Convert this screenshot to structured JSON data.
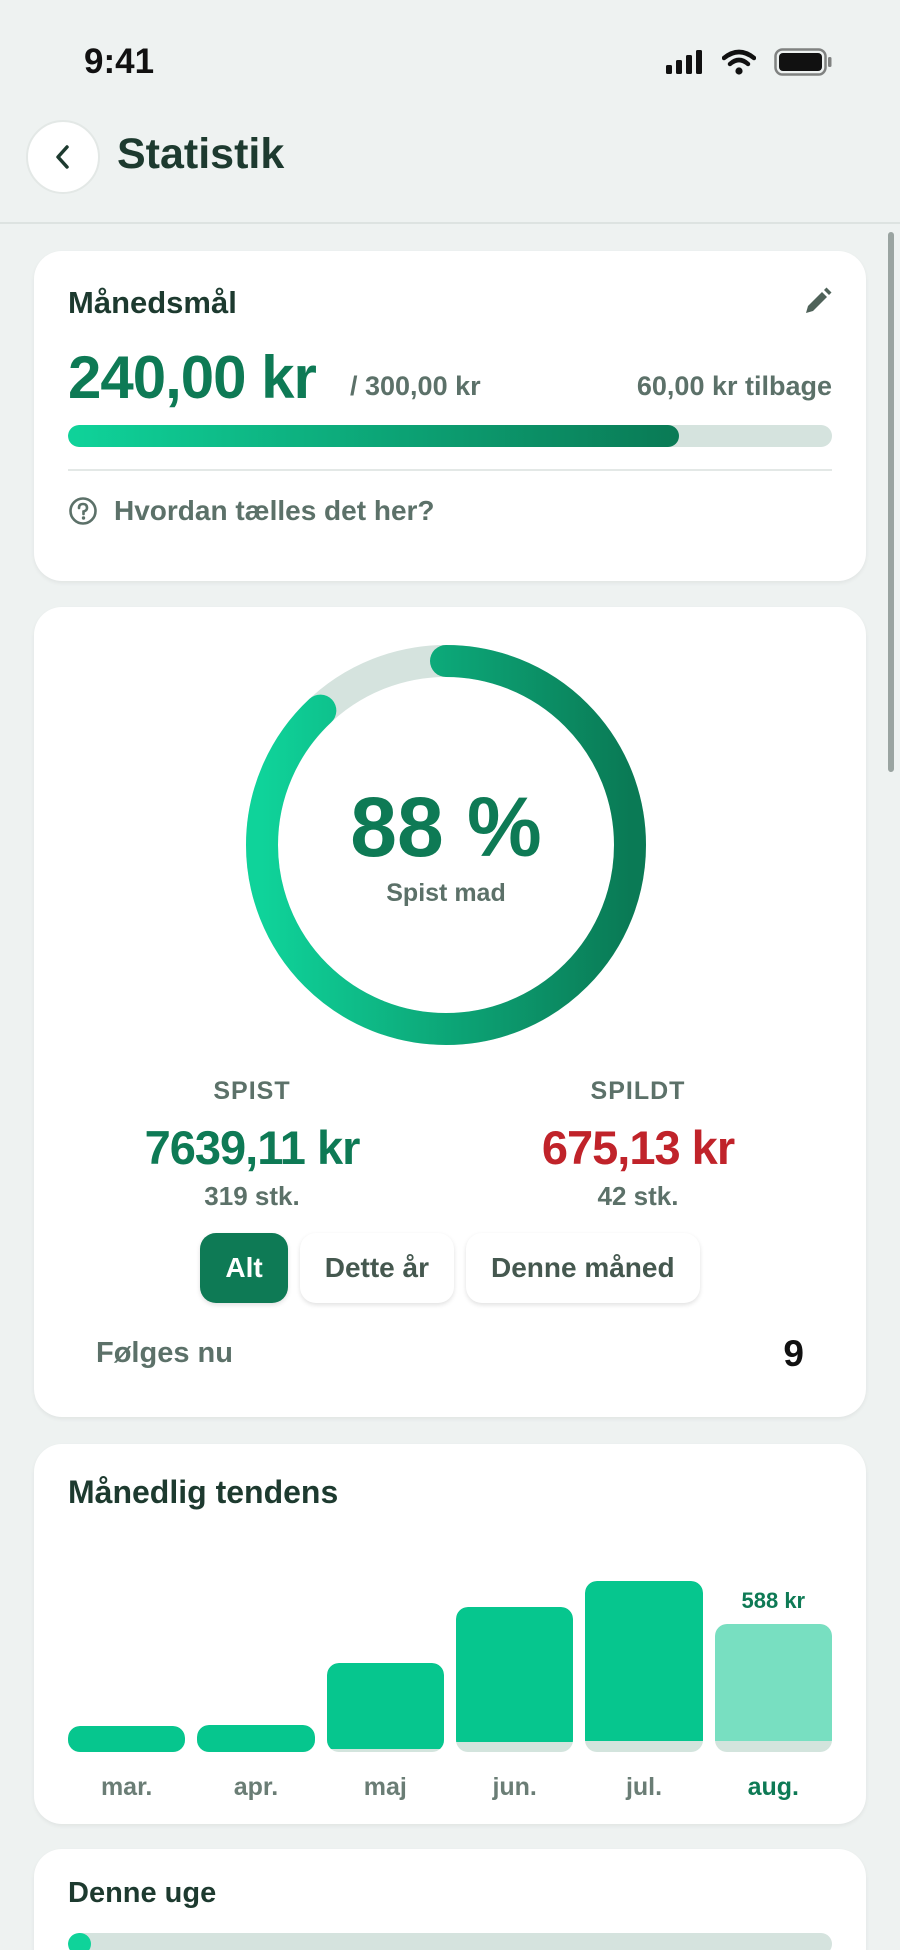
{
  "status_bar": {
    "time": "9:41"
  },
  "nav": {
    "title": "Statistik",
    "back_icon": "chevron-left-icon"
  },
  "goal": {
    "title": "Månedsmål",
    "amount": "240,00 kr",
    "total": "/ 300,00 kr",
    "remaining": "60,00 kr tilbage",
    "progress": 0.8,
    "help_text": "Hvordan tælles det her?"
  },
  "summary": {
    "percent_label": "88 %",
    "percent": 0.88,
    "caption": "Spist mad",
    "eaten": {
      "heading": "SPIST",
      "amount": "7639,11 kr",
      "count": "319 stk."
    },
    "wasted": {
      "heading": "SPILDT",
      "amount": "675,13 kr",
      "count": "42 stk."
    },
    "filters": [
      {
        "label": "Alt",
        "active": true
      },
      {
        "label": "Dette år",
        "active": false
      },
      {
        "label": "Denne måned",
        "active": false
      }
    ],
    "following_label": "Følges nu",
    "following_value": "9"
  },
  "trend": {
    "title": "Månedlig tendens",
    "max_value": 588,
    "bars": [
      {
        "label": "mar.",
        "fill": 0.16,
        "total": 0.16,
        "current": false,
        "value_label": ""
      },
      {
        "label": "apr.",
        "fill": 0.17,
        "total": 0.17,
        "current": false,
        "value_label": ""
      },
      {
        "label": "maj",
        "fill": 0.53,
        "total": 0.55,
        "current": false,
        "value_label": ""
      },
      {
        "label": "jun.",
        "fill": 0.84,
        "total": 0.9,
        "current": false,
        "value_label": ""
      },
      {
        "label": "jul.",
        "fill": 0.99,
        "total": 1.06,
        "current": false,
        "value_label": ""
      },
      {
        "label": "aug.",
        "fill": 0.72,
        "total": 0.79,
        "current": true,
        "value_label": "588 kr"
      }
    ]
  },
  "week": {
    "title": "Denne uge",
    "progress": 0.03
  },
  "colors": {
    "accent": "#0e7a55",
    "accent_light": "#06c68e",
    "danger": "#c0232a"
  }
}
